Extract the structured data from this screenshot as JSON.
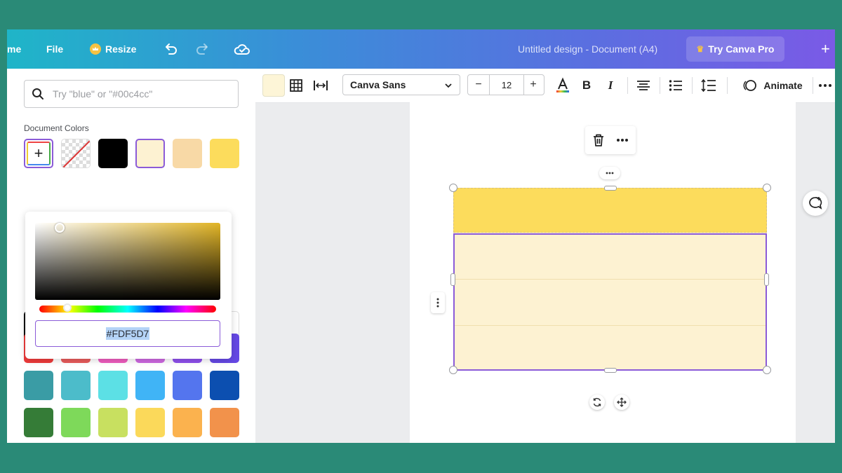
{
  "topbar": {
    "home_label": "me",
    "file_label": "File",
    "resize_label": "Resize",
    "doc_title": "Untitled design - Document (A4)",
    "pro_label": "Try Canva Pro",
    "plus_label": "+"
  },
  "panel": {
    "search_placeholder": "Try \"blue\" or \"#00c4cc\"",
    "doc_colors_title": "Document Colors",
    "document_colors": [
      {
        "type": "add",
        "color": "#ffffff"
      },
      {
        "type": "transparent",
        "color": "transparent"
      },
      {
        "type": "swatch",
        "color": "#000000"
      },
      {
        "type": "swatch",
        "color": "#fdf2d2",
        "selected": true
      },
      {
        "type": "swatch",
        "color": "#f8d9a6"
      },
      {
        "type": "swatch",
        "color": "#fcdc5c"
      }
    ],
    "default_colors": [
      [
        "#000000",
        "#595959",
        "#7f7f7f",
        "#a6a6a6",
        "#d9d9d9",
        "#ffffff"
      ],
      [
        "#ee3b3b",
        "#e85b5b",
        "#ee5cbe",
        "#cd68e0",
        "#8e4fec",
        "#6548e4"
      ],
      [
        "#3a9ca5",
        "#4cbcca",
        "#5ce0e5",
        "#40b4f6",
        "#5475ee",
        "#0c4fb0"
      ],
      [
        "#357c37",
        "#7ed95a",
        "#c8e060",
        "#fbd95a",
        "#fbb24e",
        "#f2924b"
      ]
    ],
    "picker": {
      "hex_value": "#FDF5D7",
      "hue_color": "#e2b526"
    }
  },
  "toolbar": {
    "font_name": "Canva Sans",
    "font_size": "12",
    "minus_label": "−",
    "plus_label": "+",
    "animate_label": "Animate",
    "text_color_bar": "#e44"
  },
  "canvas": {
    "header_row_color": "#fcdc5c",
    "body_row_color": "#fdf2d2",
    "selection_color": "#8b5bd8"
  }
}
